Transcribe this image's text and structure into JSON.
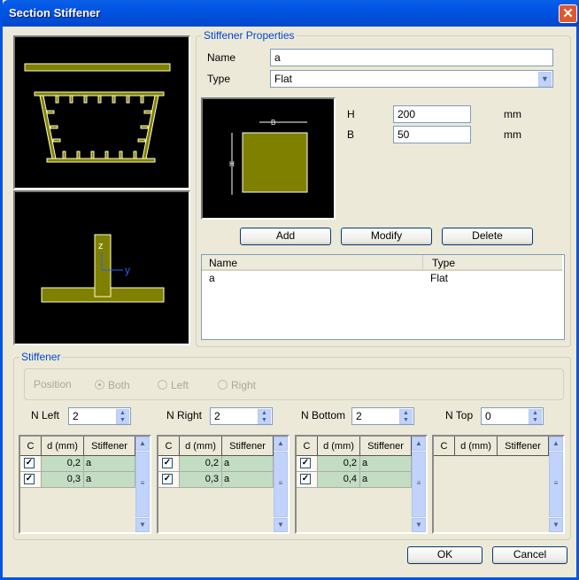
{
  "window": {
    "title": "Section Stiffener",
    "close": "✕"
  },
  "properties": {
    "group_label": "Stiffener Properties",
    "name_label": "Name",
    "name_value": "a",
    "type_label": "Type",
    "type_value": "Flat",
    "h_label": "H",
    "h_value": "200",
    "h_unit": "mm",
    "b_label": "B",
    "b_value": "50",
    "b_unit": "mm",
    "diagram_b": "B",
    "diagram_h": "H"
  },
  "buttons": {
    "add": "Add",
    "modify": "Modify",
    "delete": "Delete",
    "ok": "OK",
    "cancel": "Cancel"
  },
  "list": {
    "headers": [
      "Name",
      "Type"
    ],
    "rows": [
      {
        "name": "a",
        "type": "Flat"
      }
    ]
  },
  "axes": {
    "z": "z",
    "y": "y"
  },
  "stiffener": {
    "group_label": "Stiffener",
    "position_label": "Position",
    "options": [
      "Both",
      "Left",
      "Right"
    ],
    "selected": "Both"
  },
  "counts": [
    {
      "label": "N Left",
      "value": "2"
    },
    {
      "label": "N Right",
      "value": "2"
    },
    {
      "label": "N Bottom",
      "value": "2"
    },
    {
      "label": "N Top",
      "value": "0"
    }
  ],
  "grid_headers": [
    "C",
    "d (mm)",
    "Stiffener"
  ],
  "grids": [
    [
      {
        "c": true,
        "d": "0,2",
        "s": "a"
      },
      {
        "c": true,
        "d": "0,3",
        "s": "a"
      }
    ],
    [
      {
        "c": true,
        "d": "0,2",
        "s": "a"
      },
      {
        "c": true,
        "d": "0,3",
        "s": "a"
      }
    ],
    [
      {
        "c": true,
        "d": "0,2",
        "s": "a"
      },
      {
        "c": true,
        "d": "0,4",
        "s": "a"
      }
    ],
    []
  ],
  "colors": {
    "olive": "#808000",
    "title": "#0054E3",
    "accent": "#0046D5"
  }
}
